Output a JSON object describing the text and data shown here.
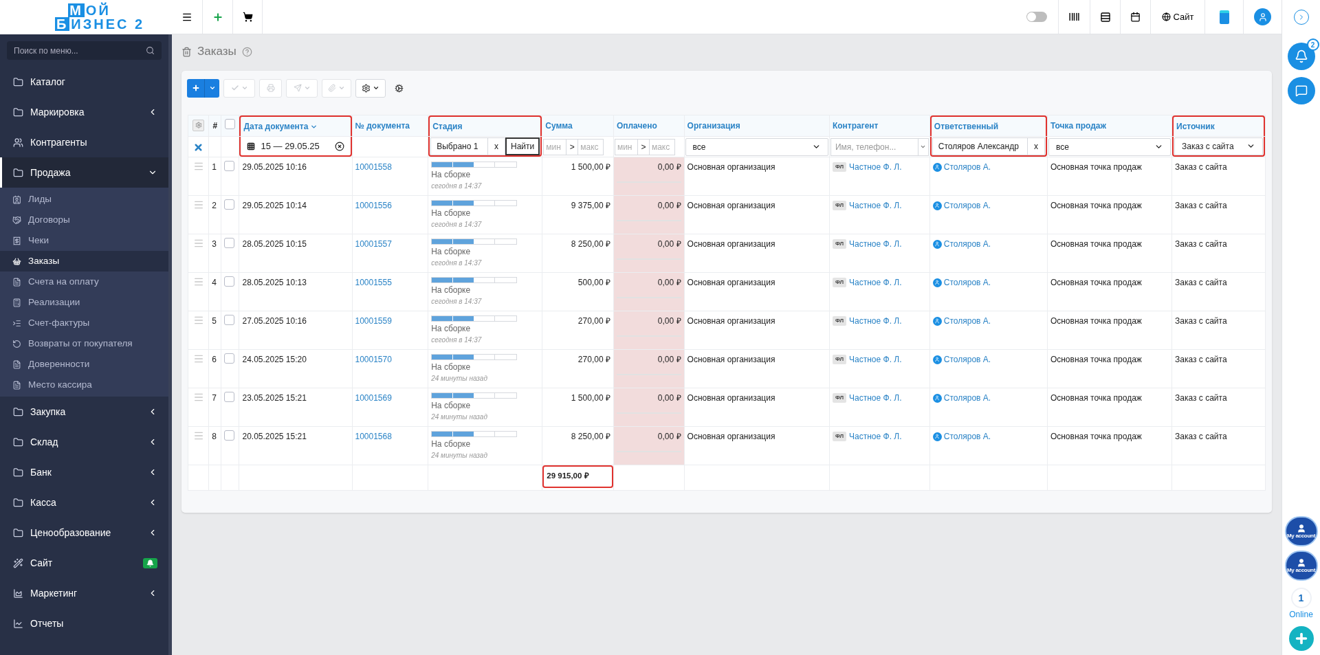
{
  "logo": {
    "mark1": "М",
    "line1": "ОЙ",
    "mark2": "Б",
    "line2": "ИЗНЕС 2"
  },
  "sidebar": {
    "search": {
      "placeholder": "Поиск по меню..."
    },
    "items": [
      {
        "label": "Каталог",
        "selected": false
      },
      {
        "label": "Маркировка",
        "selected": false,
        "expanded": false
      },
      {
        "label": "Контрагенты",
        "selected": false
      },
      {
        "label": "Продажа",
        "selected": true,
        "expanded": true,
        "children": [
          {
            "label": "Лиды",
            "selected": false
          },
          {
            "label": "Договоры",
            "selected": false
          },
          {
            "label": "Чеки",
            "selected": false
          },
          {
            "label": "Заказы",
            "selected": true
          },
          {
            "label": "Счета на оплату",
            "selected": false
          },
          {
            "label": "Реализации",
            "selected": false
          },
          {
            "label": "Счет-фактуры",
            "selected": false
          },
          {
            "label": "Возвраты от покупателя",
            "selected": false
          },
          {
            "label": "Доверенности",
            "selected": false
          },
          {
            "label": "Место кассира",
            "selected": false
          }
        ]
      },
      {
        "label": "Закупка",
        "selected": false,
        "expanded": false
      },
      {
        "label": "Склад",
        "selected": false,
        "expanded": false
      },
      {
        "label": "Банк",
        "selected": false,
        "expanded": false
      },
      {
        "label": "Касса",
        "selected": false,
        "expanded": false
      },
      {
        "label": "Ценообразование",
        "selected": false,
        "expanded": false
      },
      {
        "label": "Сайт",
        "selected": false,
        "notification": true
      },
      {
        "label": "Маркетинг",
        "selected": false,
        "expanded": false
      },
      {
        "label": "Отчеты",
        "selected": false
      }
    ]
  },
  "topbar": {
    "dark_mode": {
      "on": false
    },
    "site_link": "Сайт"
  },
  "page": {
    "title": "Заказы"
  },
  "toolbar": {
    "buttons": [
      {
        "kind": "add",
        "disabled": false
      },
      {
        "kind": "check",
        "disabled": true
      },
      {
        "kind": "print",
        "disabled": true
      },
      {
        "kind": "send",
        "disabled": true
      },
      {
        "kind": "attach",
        "disabled": true
      },
      {
        "kind": "settings",
        "disabled": false
      },
      {
        "kind": "cogs",
        "disabled": false
      }
    ]
  },
  "table": {
    "number_header": "#",
    "select_all": {
      "checked": false
    },
    "columns": [
      {
        "label": "Дата документа",
        "sorted": true,
        "highlighted": true,
        "filter": {
          "kind": "date_range",
          "value": "15 — 29.05.25"
        }
      },
      {
        "label": "№ документа",
        "sorted": false,
        "highlighted": false,
        "filter": {
          "kind": "none"
        }
      },
      {
        "label": "Стадия",
        "sorted": false,
        "highlighted": true,
        "filter": {
          "kind": "multi",
          "value": "Выбрано 1",
          "clear": "x",
          "action": "Найти"
        }
      },
      {
        "label": "Сумма",
        "sorted": false,
        "highlighted": false,
        "filter": {
          "kind": "range",
          "from": {
            "placeholder": "мин"
          },
          "sep": ">",
          "to": {
            "placeholder": "макс"
          }
        }
      },
      {
        "label": "Оплачено",
        "sorted": false,
        "highlighted": false,
        "filter": {
          "kind": "range",
          "from": {
            "placeholder": "мин"
          },
          "sep": ">",
          "to": {
            "placeholder": "макс"
          }
        }
      },
      {
        "label": "Организация",
        "sorted": false,
        "highlighted": false,
        "filter": {
          "kind": "select",
          "value": "все"
        }
      },
      {
        "label": "Контрагент",
        "sorted": false,
        "highlighted": false,
        "filter": {
          "kind": "text",
          "placeholder": "Имя, телефон..."
        }
      },
      {
        "label": "Ответственный",
        "sorted": false,
        "highlighted": true,
        "filter": {
          "kind": "tag",
          "value": "Столяров Александр",
          "clear": "x"
        }
      },
      {
        "label": "Точка продаж",
        "sorted": false,
        "highlighted": false,
        "filter": {
          "kind": "select",
          "value": "все"
        }
      },
      {
        "label": "Источник",
        "sorted": false,
        "highlighted": true,
        "filter": {
          "kind": "select",
          "value": "Заказ с сайта"
        }
      }
    ],
    "rows": [
      {
        "n": "1",
        "checked": false,
        "date": "29.05.2025 10:16",
        "number": "10001558",
        "stage": {
          "level": 0.5,
          "label": "На сборке",
          "time": "сегодня в 14:37"
        },
        "sum": "1 500,00 ₽",
        "paid": {
          "text": "0,00 ₽",
          "level": 0
        },
        "org": "Основная организация",
        "party_type": "ФЛ",
        "party": "Частное Ф. Л.",
        "owner": "Столяров А.",
        "point": "Основная точка продаж",
        "source": "Заказ с сайта"
      },
      {
        "n": "2",
        "checked": false,
        "date": "29.05.2025 10:14",
        "number": "10001556",
        "stage": {
          "level": 0.5,
          "label": "На сборке",
          "time": "сегодня в 14:37"
        },
        "sum": "9 375,00 ₽",
        "paid": {
          "text": "0,00 ₽",
          "level": 0
        },
        "org": "Основная организация",
        "party_type": "ФЛ",
        "party": "Частное Ф. Л.",
        "owner": "Столяров А.",
        "point": "Основная точка продаж",
        "source": "Заказ с сайта"
      },
      {
        "n": "3",
        "checked": false,
        "date": "28.05.2025 10:15",
        "number": "10001557",
        "stage": {
          "level": 0.5,
          "label": "На сборке",
          "time": "сегодня в 14:37"
        },
        "sum": "8 250,00 ₽",
        "paid": {
          "text": "0,00 ₽",
          "level": 0
        },
        "org": "Основная организация",
        "party_type": "ФЛ",
        "party": "Частное Ф. Л.",
        "owner": "Столяров А.",
        "point": "Основная точка продаж",
        "source": "Заказ с сайта"
      },
      {
        "n": "4",
        "checked": false,
        "date": "28.05.2025 10:13",
        "number": "10001555",
        "stage": {
          "level": 0.5,
          "label": "На сборке",
          "time": "сегодня в 14:37"
        },
        "sum": "500,00 ₽",
        "paid": {
          "text": "0,00 ₽",
          "level": 0
        },
        "org": "Основная организация",
        "party_type": "ФЛ",
        "party": "Частное Ф. Л.",
        "owner": "Столяров А.",
        "point": "Основная точка продаж",
        "source": "Заказ с сайта"
      },
      {
        "n": "5",
        "checked": false,
        "date": "27.05.2025 10:16",
        "number": "10001559",
        "stage": {
          "level": 0.5,
          "label": "На сборке",
          "time": "сегодня в 14:37"
        },
        "sum": "270,00 ₽",
        "paid": {
          "text": "0,00 ₽",
          "level": 0
        },
        "org": "Основная организация",
        "party_type": "ФЛ",
        "party": "Частное Ф. Л.",
        "owner": "Столяров А.",
        "point": "Основная точка продаж",
        "source": "Заказ с сайта"
      },
      {
        "n": "6",
        "checked": false,
        "date": "24.05.2025 15:20",
        "number": "10001570",
        "stage": {
          "level": 0.5,
          "label": "На сборке",
          "time": "24 минуты назад"
        },
        "sum": "270,00 ₽",
        "paid": {
          "text": "0,00 ₽",
          "level": 0
        },
        "org": "Основная организация",
        "party_type": "ФЛ",
        "party": "Частное Ф. Л.",
        "owner": "Столяров А.",
        "point": "Основная точка продаж",
        "source": "Заказ с сайта"
      },
      {
        "n": "7",
        "checked": false,
        "date": "23.05.2025 15:21",
        "number": "10001569",
        "stage": {
          "level": 0.5,
          "label": "На сборке",
          "time": "24 минуты назад"
        },
        "sum": "1 500,00 ₽",
        "paid": {
          "text": "0,00 ₽",
          "level": 0
        },
        "org": "Основная организация",
        "party_type": "ФЛ",
        "party": "Частное Ф. Л.",
        "owner": "Столяров А.",
        "point": "Основная точка продаж",
        "source": "Заказ с сайта"
      },
      {
        "n": "8",
        "checked": false,
        "date": "20.05.2025 15:21",
        "number": "10001568",
        "stage": {
          "level": 0.5,
          "label": "На сборке",
          "time": "24 минуты назад"
        },
        "sum": "8 250,00 ₽",
        "paid": {
          "text": "0,00 ₽",
          "level": 0
        },
        "org": "Основная организация",
        "party_type": "ФЛ",
        "party": "Частное Ф. Л.",
        "owner": "Столяров А.",
        "point": "Основная точка продаж",
        "source": "Заказ с сайта"
      }
    ],
    "total": {
      "text": "29 915,00 ₽",
      "highlighted": true
    }
  },
  "right_rail": {
    "notifications_badge": "2",
    "accounts": [
      {
        "label": "My account"
      },
      {
        "label": "My account"
      }
    ],
    "online_count": "1",
    "online_label": "Online"
  }
}
